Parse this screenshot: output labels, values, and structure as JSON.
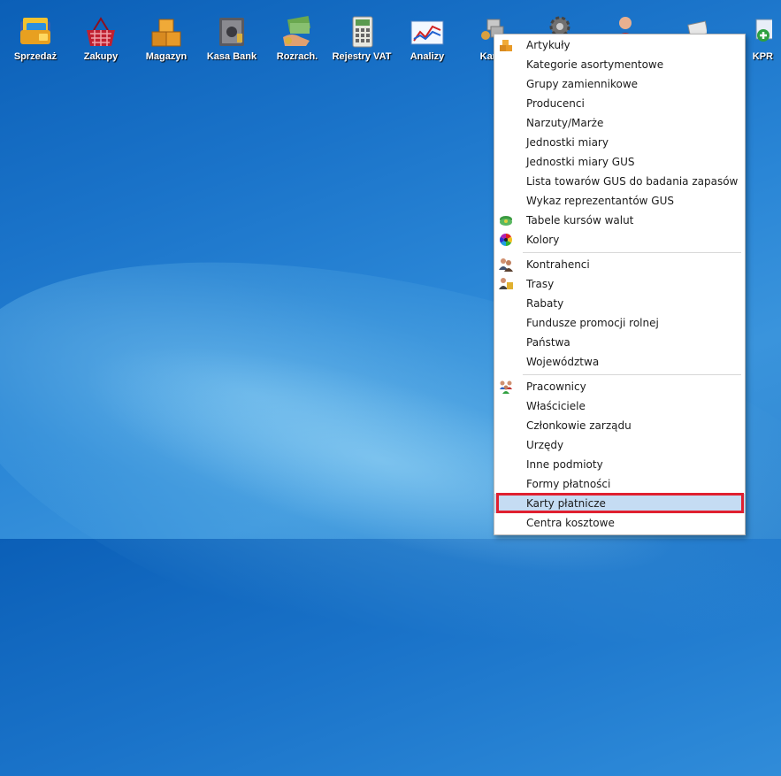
{
  "toolbar": {
    "items": [
      {
        "label": "Sprzedaż",
        "icon": "wallet-cards-icon"
      },
      {
        "label": "Zakupy",
        "icon": "shopping-basket-icon"
      },
      {
        "label": "Magazyn",
        "icon": "boxes-icon"
      },
      {
        "label": "Kasa Bank",
        "icon": "safe-icon"
      },
      {
        "label": "Rozrach.",
        "icon": "money-hand-icon"
      },
      {
        "label": "Rejestry VAT",
        "icon": "calculator-icon"
      },
      {
        "label": "Analizy",
        "icon": "chart-icon"
      },
      {
        "label": "Kartoteki",
        "visible_label": "Karto",
        "icon": "truck-boxes-icon"
      },
      {
        "label": "",
        "icon": "gear-icon"
      },
      {
        "label": "",
        "icon": "person-icon"
      },
      {
        "label": "",
        "icon": "documents-icon"
      },
      {
        "label": "KPR",
        "icon": "kpr-add-icon"
      }
    ]
  },
  "menu": {
    "items": [
      {
        "label": "Artykuły",
        "icon": "boxes-icon"
      },
      {
        "label": "Kategorie asortymentowe"
      },
      {
        "label": "Grupy zamiennikowe"
      },
      {
        "label": "Producenci"
      },
      {
        "label": "Narzuty/Marże"
      },
      {
        "label": "Jednostki miary"
      },
      {
        "label": "Jednostki miary GUS"
      },
      {
        "label": "Lista towarów GUS do badania zapasów"
      },
      {
        "label": "Wykaz reprezentantów GUS"
      },
      {
        "label": "Tabele kursów walut",
        "icon": "currency-icon"
      },
      {
        "label": "Kolory",
        "icon": "color-wheel-icon"
      },
      {
        "label": "Kontrahenci",
        "icon": "people-icon"
      },
      {
        "label": "Trasy",
        "icon": "route-people-icon"
      },
      {
        "label": "Rabaty"
      },
      {
        "label": "Fundusze promocji rolnej"
      },
      {
        "label": "Państwa"
      },
      {
        "label": "Województwa"
      },
      {
        "label": "Pracownicy",
        "icon": "workers-icon"
      },
      {
        "label": "Właściciele"
      },
      {
        "label": "Członkowie zarządu"
      },
      {
        "label": "Urzędy"
      },
      {
        "label": "Inne podmioty"
      },
      {
        "label": "Formy płatności"
      },
      {
        "label": "Karty płatnicze",
        "selected": true
      },
      {
        "label": "Centra kosztowe"
      }
    ]
  },
  "colors": {
    "desktop_blue": "#1a73c9",
    "menu_selected": "#c5dcf3",
    "highlight_border": "#e02030"
  }
}
